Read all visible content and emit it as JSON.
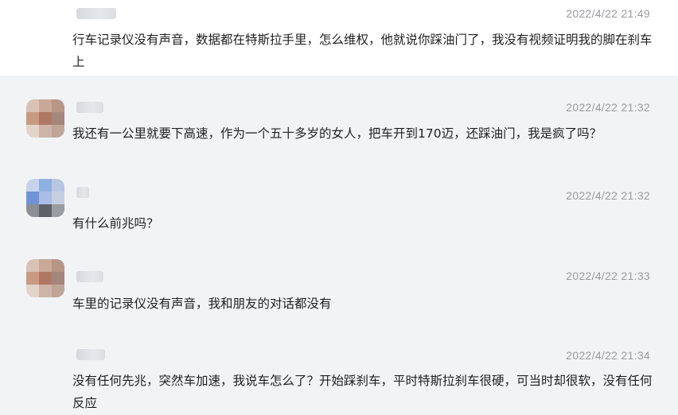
{
  "messages": [
    {
      "time": "2022/4/22 21:49",
      "text": "行车记录仪没有声音，数据都在特斯拉手里，怎么维权，他就说你踩油门了，我没有视频证明我的脚在刹车上"
    },
    {
      "time": "2022/4/22 21:32",
      "text": "我还有一公里就要下高速，作为一个五十多岁的女人，把车开到170迈，还踩油门，我是疯了吗？"
    },
    {
      "time": "2022/4/22 21:32",
      "text": "有什么前兆吗？"
    },
    {
      "time": "2022/4/22 21:33",
      "text": "车里的记录仪没有声音，我和朋友的对话都没有"
    },
    {
      "time": "2022/4/22 21:34",
      "text": "没有任何先兆，突然车加速，我说车怎么了？开始踩刹车，平时特斯拉刹车很硬，可当时却很软，没有任何反应"
    }
  ]
}
